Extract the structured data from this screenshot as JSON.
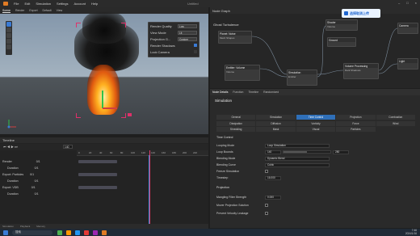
{
  "app": {
    "title": "EmberGen",
    "window_title": "Untitled"
  },
  "menu": [
    "File",
    "Edit",
    "Simulation",
    "Settings",
    "Account",
    "Help"
  ],
  "viewport_tabs": [
    "Scene",
    "Render",
    "Export",
    "Default",
    "View"
  ],
  "viewport_popup": {
    "render_quality_label": "Render Quality",
    "render_quality_value": "Low",
    "view_mode_label": "View Mode",
    "view_mode_value": "Lit",
    "projection_label": "Projection G...",
    "projection_value": "Custom",
    "render_shadows_label": "Render Shadows",
    "lock_camera_label": "Lock Camera"
  },
  "timeline": {
    "title": "Timeline",
    "frame": "140",
    "ruler": [
      "0",
      "20",
      "40",
      "60",
      "80",
      "100",
      "120",
      "140",
      "160",
      "180",
      "200",
      "220"
    ],
    "tracks": [
      {
        "label": "Render",
        "value": "0/1"
      },
      {
        "label": "Duration",
        "value": "0/1"
      },
      {
        "label": "Export: Particles",
        "value": "0/1"
      },
      {
        "label": "Duration",
        "value": "0/1"
      },
      {
        "label": "Export: VDB",
        "value": "0/1"
      },
      {
        "label": "Duration",
        "value": "0/1"
      }
    ],
    "status": [
      "Simulation",
      "Playback",
      "Memory"
    ]
  },
  "node_graph": {
    "title": "Node Graph",
    "group_label": "Ghost Turbulence",
    "nodes": [
      {
        "title": "Planet: Noise",
        "ports": [
          "Flow",
          "Mesh Shapes",
          "Noise"
        ]
      },
      {
        "title": "Emitter: Volume",
        "ports": [
          "Volume",
          "Volume",
          "Mask"
        ]
      },
      {
        "title": "Simulation",
        "ports": [
          "Emitter",
          "Forces",
          "Volume"
        ]
      },
      {
        "title": "Shader",
        "ports": [
          "Volume"
        ]
      },
      {
        "title": "Ground",
        "ports": [
          "Ground"
        ]
      },
      {
        "title": "Volume Processing",
        "ports": [
          "Volume",
          "Dark Shadows"
        ]
      },
      {
        "title": "Camera",
        "ports": [
          "Camera"
        ]
      },
      {
        "title": "Light",
        "ports": [
          "Light"
        ]
      }
    ]
  },
  "notice": {
    "text": "选择取消上传"
  },
  "inspector": {
    "tabs": [
      "Node Details",
      "Function",
      "Timeline",
      "Randomized"
    ],
    "title": "Simulation",
    "subtabs": [
      "General",
      "Simulation",
      "Time Control",
      "Projection",
      "Combustion",
      "Dissipation",
      "Diffusion",
      "Vorticity",
      "Force",
      "Wind",
      "Shredding",
      "Mask",
      "Visual",
      "Particles",
      ""
    ],
    "active_subtab": "Time Control",
    "section_time": "Time Control",
    "rows": [
      {
        "label": "Looping Mode",
        "value": "Loop Simulation"
      },
      {
        "label": "Loop Bounds",
        "value": "140",
        "value2": "280"
      },
      {
        "label": "Blending Mode",
        "value": "Dynamic Blend"
      },
      {
        "label": "Blending Curve",
        "value": "Cubic"
      },
      {
        "label": "Freeze Simulation",
        "value": ""
      },
      {
        "label": "Timestep",
        "value": "16.000"
      }
    ],
    "section_projection": "Projection",
    "rows2": [
      {
        "label": "Mangling Filter Strength",
        "value": "0.000"
      },
      {
        "label": "Mover Projection Solution",
        "value": ""
      },
      {
        "label": "Prevent Velocity Leakage",
        "value": ""
      }
    ]
  },
  "taskbar": {
    "search": "搜索",
    "time": "7:46",
    "date": "2024/1/16"
  }
}
